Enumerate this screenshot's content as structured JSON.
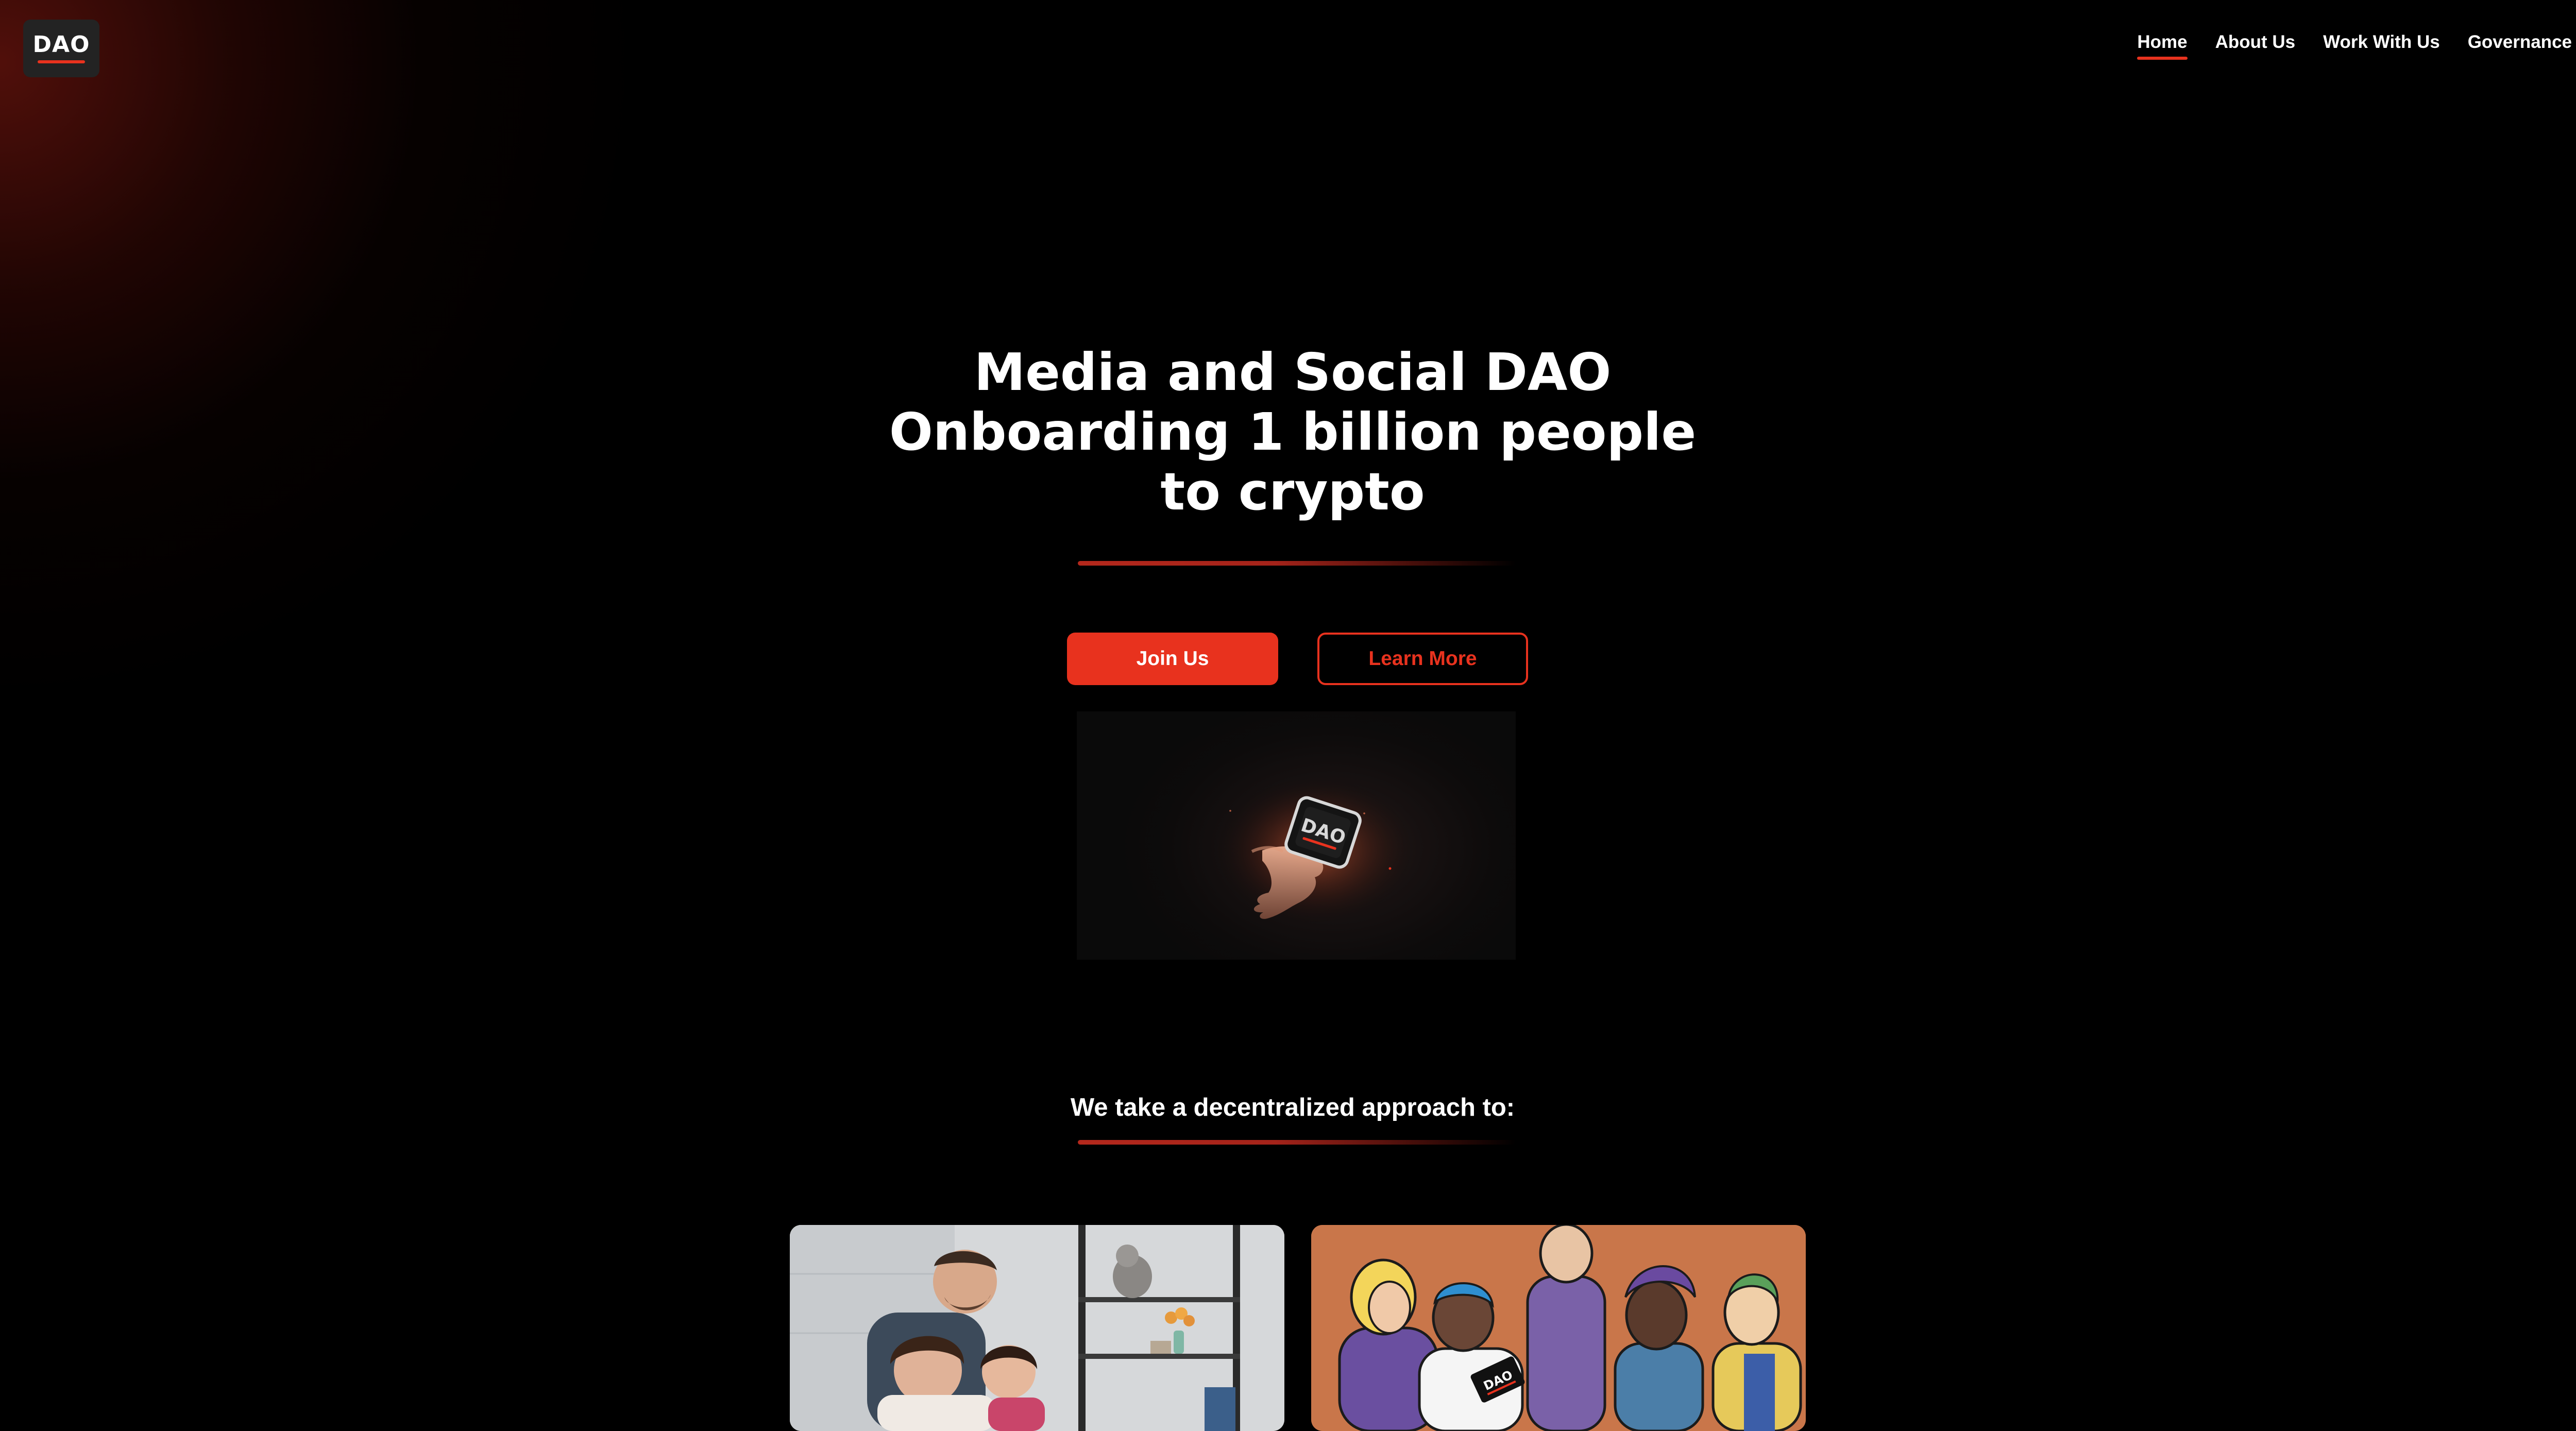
{
  "brand": {
    "logo_text": "DAO",
    "accent_color": "#e8321e"
  },
  "nav": {
    "items": [
      {
        "label": "Home",
        "active": true
      },
      {
        "label": "About Us",
        "active": false
      },
      {
        "label": "Work With Us",
        "active": false
      },
      {
        "label": "Governance",
        "active": false
      }
    ]
  },
  "hero": {
    "title_lines": [
      "Media and Social DAO",
      "Onboarding 1 billion people",
      "to crypto"
    ],
    "primary_button": "Join Us",
    "secondary_button": "Learn More",
    "media": {
      "card_text": "DAO",
      "icon": "hand-holding-dao-card"
    }
  },
  "approach": {
    "heading": "We take a decentralized approach to:",
    "cards": [
      {
        "image": "family-photo",
        "badge_text": ""
      },
      {
        "image": "illustrated-community",
        "badge_text": "DAO"
      }
    ]
  }
}
